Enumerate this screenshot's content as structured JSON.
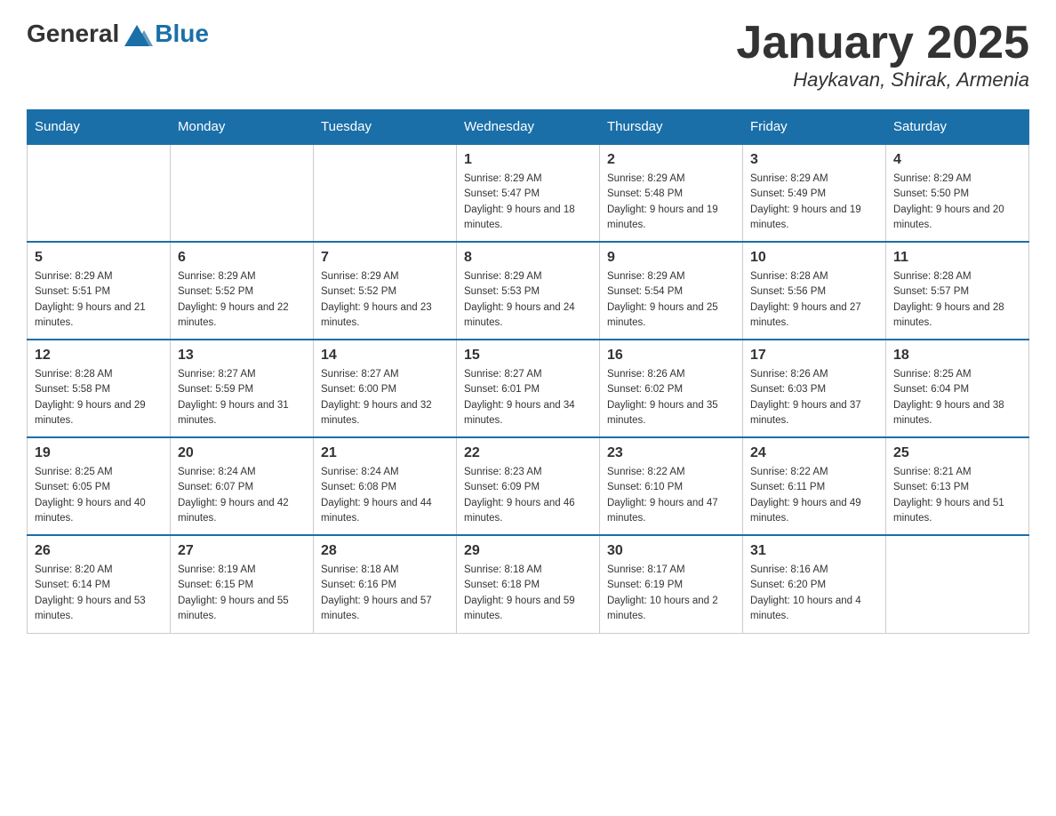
{
  "header": {
    "logo_general": "General",
    "logo_blue": "Blue",
    "month_title": "January 2025",
    "location": "Haykavan, Shirak, Armenia"
  },
  "columns": [
    "Sunday",
    "Monday",
    "Tuesday",
    "Wednesday",
    "Thursday",
    "Friday",
    "Saturday"
  ],
  "weeks": [
    [
      {
        "day": "",
        "sunrise": "",
        "sunset": "",
        "daylight": ""
      },
      {
        "day": "",
        "sunrise": "",
        "sunset": "",
        "daylight": ""
      },
      {
        "day": "",
        "sunrise": "",
        "sunset": "",
        "daylight": ""
      },
      {
        "day": "1",
        "sunrise": "Sunrise: 8:29 AM",
        "sunset": "Sunset: 5:47 PM",
        "daylight": "Daylight: 9 hours and 18 minutes."
      },
      {
        "day": "2",
        "sunrise": "Sunrise: 8:29 AM",
        "sunset": "Sunset: 5:48 PM",
        "daylight": "Daylight: 9 hours and 19 minutes."
      },
      {
        "day": "3",
        "sunrise": "Sunrise: 8:29 AM",
        "sunset": "Sunset: 5:49 PM",
        "daylight": "Daylight: 9 hours and 19 minutes."
      },
      {
        "day": "4",
        "sunrise": "Sunrise: 8:29 AM",
        "sunset": "Sunset: 5:50 PM",
        "daylight": "Daylight: 9 hours and 20 minutes."
      }
    ],
    [
      {
        "day": "5",
        "sunrise": "Sunrise: 8:29 AM",
        "sunset": "Sunset: 5:51 PM",
        "daylight": "Daylight: 9 hours and 21 minutes."
      },
      {
        "day": "6",
        "sunrise": "Sunrise: 8:29 AM",
        "sunset": "Sunset: 5:52 PM",
        "daylight": "Daylight: 9 hours and 22 minutes."
      },
      {
        "day": "7",
        "sunrise": "Sunrise: 8:29 AM",
        "sunset": "Sunset: 5:52 PM",
        "daylight": "Daylight: 9 hours and 23 minutes."
      },
      {
        "day": "8",
        "sunrise": "Sunrise: 8:29 AM",
        "sunset": "Sunset: 5:53 PM",
        "daylight": "Daylight: 9 hours and 24 minutes."
      },
      {
        "day": "9",
        "sunrise": "Sunrise: 8:29 AM",
        "sunset": "Sunset: 5:54 PM",
        "daylight": "Daylight: 9 hours and 25 minutes."
      },
      {
        "day": "10",
        "sunrise": "Sunrise: 8:28 AM",
        "sunset": "Sunset: 5:56 PM",
        "daylight": "Daylight: 9 hours and 27 minutes."
      },
      {
        "day": "11",
        "sunrise": "Sunrise: 8:28 AM",
        "sunset": "Sunset: 5:57 PM",
        "daylight": "Daylight: 9 hours and 28 minutes."
      }
    ],
    [
      {
        "day": "12",
        "sunrise": "Sunrise: 8:28 AM",
        "sunset": "Sunset: 5:58 PM",
        "daylight": "Daylight: 9 hours and 29 minutes."
      },
      {
        "day": "13",
        "sunrise": "Sunrise: 8:27 AM",
        "sunset": "Sunset: 5:59 PM",
        "daylight": "Daylight: 9 hours and 31 minutes."
      },
      {
        "day": "14",
        "sunrise": "Sunrise: 8:27 AM",
        "sunset": "Sunset: 6:00 PM",
        "daylight": "Daylight: 9 hours and 32 minutes."
      },
      {
        "day": "15",
        "sunrise": "Sunrise: 8:27 AM",
        "sunset": "Sunset: 6:01 PM",
        "daylight": "Daylight: 9 hours and 34 minutes."
      },
      {
        "day": "16",
        "sunrise": "Sunrise: 8:26 AM",
        "sunset": "Sunset: 6:02 PM",
        "daylight": "Daylight: 9 hours and 35 minutes."
      },
      {
        "day": "17",
        "sunrise": "Sunrise: 8:26 AM",
        "sunset": "Sunset: 6:03 PM",
        "daylight": "Daylight: 9 hours and 37 minutes."
      },
      {
        "day": "18",
        "sunrise": "Sunrise: 8:25 AM",
        "sunset": "Sunset: 6:04 PM",
        "daylight": "Daylight: 9 hours and 38 minutes."
      }
    ],
    [
      {
        "day": "19",
        "sunrise": "Sunrise: 8:25 AM",
        "sunset": "Sunset: 6:05 PM",
        "daylight": "Daylight: 9 hours and 40 minutes."
      },
      {
        "day": "20",
        "sunrise": "Sunrise: 8:24 AM",
        "sunset": "Sunset: 6:07 PM",
        "daylight": "Daylight: 9 hours and 42 minutes."
      },
      {
        "day": "21",
        "sunrise": "Sunrise: 8:24 AM",
        "sunset": "Sunset: 6:08 PM",
        "daylight": "Daylight: 9 hours and 44 minutes."
      },
      {
        "day": "22",
        "sunrise": "Sunrise: 8:23 AM",
        "sunset": "Sunset: 6:09 PM",
        "daylight": "Daylight: 9 hours and 46 minutes."
      },
      {
        "day": "23",
        "sunrise": "Sunrise: 8:22 AM",
        "sunset": "Sunset: 6:10 PM",
        "daylight": "Daylight: 9 hours and 47 minutes."
      },
      {
        "day": "24",
        "sunrise": "Sunrise: 8:22 AM",
        "sunset": "Sunset: 6:11 PM",
        "daylight": "Daylight: 9 hours and 49 minutes."
      },
      {
        "day": "25",
        "sunrise": "Sunrise: 8:21 AM",
        "sunset": "Sunset: 6:13 PM",
        "daylight": "Daylight: 9 hours and 51 minutes."
      }
    ],
    [
      {
        "day": "26",
        "sunrise": "Sunrise: 8:20 AM",
        "sunset": "Sunset: 6:14 PM",
        "daylight": "Daylight: 9 hours and 53 minutes."
      },
      {
        "day": "27",
        "sunrise": "Sunrise: 8:19 AM",
        "sunset": "Sunset: 6:15 PM",
        "daylight": "Daylight: 9 hours and 55 minutes."
      },
      {
        "day": "28",
        "sunrise": "Sunrise: 8:18 AM",
        "sunset": "Sunset: 6:16 PM",
        "daylight": "Daylight: 9 hours and 57 minutes."
      },
      {
        "day": "29",
        "sunrise": "Sunrise: 8:18 AM",
        "sunset": "Sunset: 6:18 PM",
        "daylight": "Daylight: 9 hours and 59 minutes."
      },
      {
        "day": "30",
        "sunrise": "Sunrise: 8:17 AM",
        "sunset": "Sunset: 6:19 PM",
        "daylight": "Daylight: 10 hours and 2 minutes."
      },
      {
        "day": "31",
        "sunrise": "Sunrise: 8:16 AM",
        "sunset": "Sunset: 6:20 PM",
        "daylight": "Daylight: 10 hours and 4 minutes."
      },
      {
        "day": "",
        "sunrise": "",
        "sunset": "",
        "daylight": ""
      }
    ]
  ]
}
